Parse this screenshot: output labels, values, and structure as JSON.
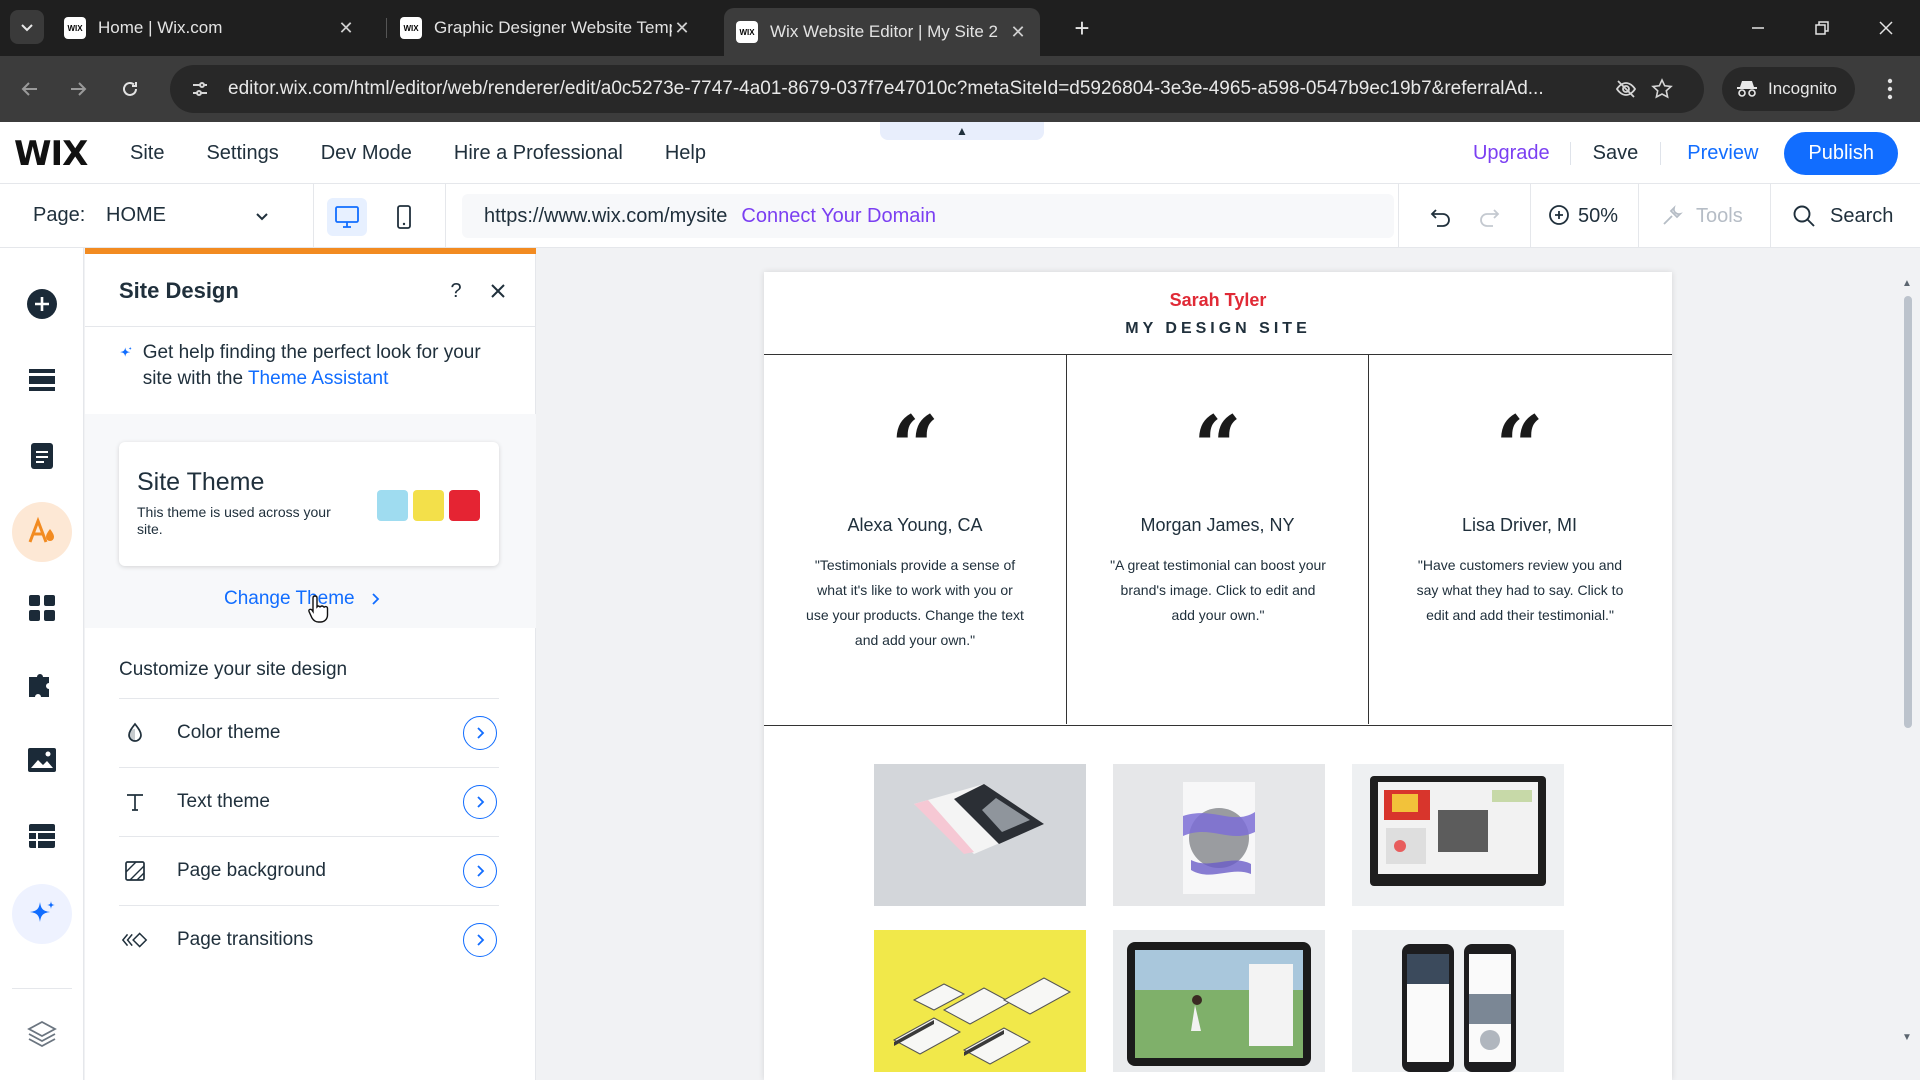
{
  "browser": {
    "tabs": [
      {
        "title": "Home | Wix.com",
        "favicon": "WIX",
        "active": false
      },
      {
        "title": "Graphic Designer Website Temp",
        "favicon": "WIX",
        "active": false
      },
      {
        "title": "Wix Website Editor | My Site 2",
        "favicon": "WIX",
        "active": true
      }
    ],
    "url": "editor.wix.com/html/editor/web/renderer/edit/a0c5273e-7747-4a01-8679-037f7e47010c?metaSiteId=d5926804-3e3e-4965-a598-0547b9ec19b7&referralAd...",
    "incognito_label": "Incognito"
  },
  "editor": {
    "logo": "WIX",
    "menu": [
      "Site",
      "Settings",
      "Dev Mode",
      "Hire a Professional",
      "Help"
    ],
    "upgrade": "Upgrade",
    "save": "Save",
    "preview": "Preview",
    "publish": "Publish",
    "page_label": "Page:",
    "page_value": "HOME",
    "site_url": "https://www.wix.com/mysite",
    "connect_domain": "Connect Your Domain",
    "zoom": "50%",
    "tools": "Tools",
    "search": "Search"
  },
  "panel": {
    "title": "Site Design",
    "assistant_text": "Get help finding the perfect look for your site with the ",
    "assistant_link": "Theme Assistant",
    "theme_card": {
      "title": "Site Theme",
      "description": "This theme is used across your site.",
      "swatches": [
        "#9fdcf0",
        "#f3e04a",
        "#e52433"
      ]
    },
    "change_theme": "Change Theme",
    "customize_title": "Customize your site design",
    "options": [
      {
        "label": "Color theme",
        "icon": "drop-icon"
      },
      {
        "label": "Text theme",
        "icon": "text-icon"
      },
      {
        "label": "Page background",
        "icon": "background-icon"
      },
      {
        "label": "Page transitions",
        "icon": "transitions-icon"
      }
    ]
  },
  "site": {
    "name": "Sarah Tyler",
    "subtitle": "MY DESIGN SITE",
    "testimonials": [
      {
        "name": "Alexa Young, CA",
        "text": "\"Testimonials provide a sense of what it's like to work with you or use your products. Change the text and add your own.\""
      },
      {
        "name": "Morgan James, NY",
        "text": "\"A great testimonial can boost your brand's image. Click to edit and add your own.\""
      },
      {
        "name": "Lisa Driver, MI",
        "text": "\"Have customers review you and say what they had to say. Click to edit and add their testimonial.\""
      }
    ],
    "quote_glyph": "“"
  },
  "colors": {
    "accent_orange": "#f28b21",
    "wix_blue": "#116dff",
    "upgrade_purple": "#7b3ff2",
    "site_name_red": "#e02a36"
  }
}
